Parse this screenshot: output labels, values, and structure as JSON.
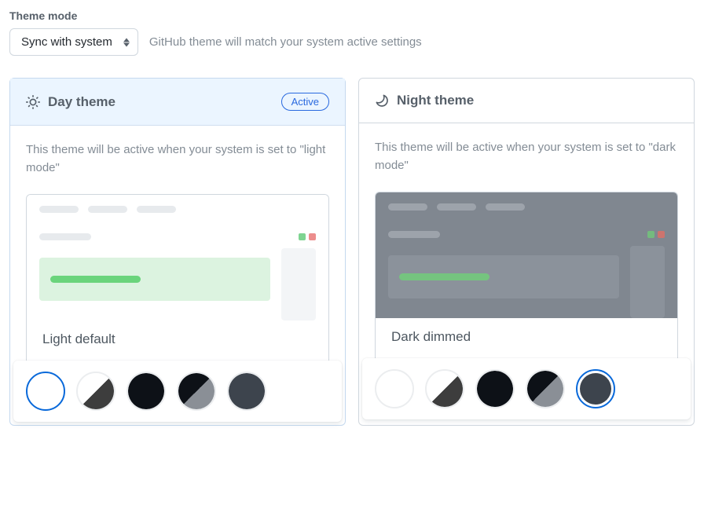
{
  "section_label": "Theme mode",
  "mode_select": {
    "value": "Sync with system"
  },
  "help_text": "GitHub theme will match your system active settings",
  "day": {
    "title": "Day theme",
    "badge": "Active",
    "desc": "This theme will be active when your system is set to \"light mode\"",
    "selected_name": "Light default",
    "swatches": [
      {
        "id": "light-default",
        "type": "solid",
        "color": "#ffffff",
        "selected": true
      },
      {
        "id": "light-high-contrast",
        "type": "split",
        "c1": "#ffffff",
        "c2": "#3d3d3d",
        "selected": false
      },
      {
        "id": "dark-default",
        "type": "solid",
        "color": "#0d1117",
        "selected": false
      },
      {
        "id": "dark-high-contrast",
        "type": "split",
        "c1": "#0d1117",
        "c2": "#8a8f96",
        "selected": false
      },
      {
        "id": "dark-dimmed",
        "type": "solid",
        "color": "#3d444d",
        "selected": false
      }
    ]
  },
  "night": {
    "title": "Night theme",
    "desc": "This theme will be active when your system is set to \"dark mode\"",
    "selected_name": "Dark dimmed",
    "swatches": [
      {
        "id": "light-default",
        "type": "solid",
        "color": "#ffffff",
        "selected": false
      },
      {
        "id": "light-high-contrast",
        "type": "split",
        "c1": "#ffffff",
        "c2": "#3d3d3d",
        "selected": false
      },
      {
        "id": "dark-default",
        "type": "solid",
        "color": "#0d1117",
        "selected": false
      },
      {
        "id": "dark-high-contrast",
        "type": "split",
        "c1": "#0d1117",
        "c2": "#8a8f96",
        "selected": false
      },
      {
        "id": "dark-dimmed",
        "type": "solid",
        "color": "#3d444d",
        "selected": true
      }
    ]
  }
}
